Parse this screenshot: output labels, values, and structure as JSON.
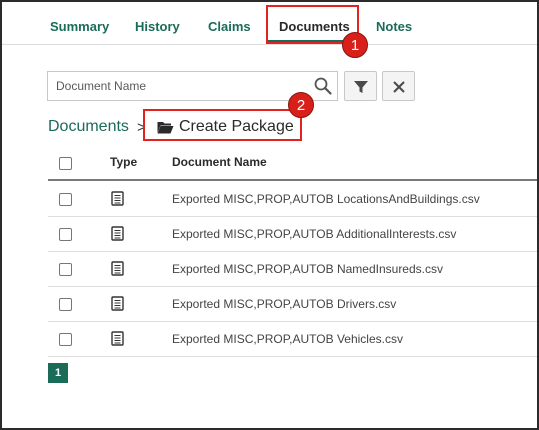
{
  "tabs": [
    {
      "label": "Summary"
    },
    {
      "label": "History"
    },
    {
      "label": "Claims"
    },
    {
      "label": "Documents",
      "active": true
    },
    {
      "label": "Notes"
    }
  ],
  "callouts": [
    "1",
    "2"
  ],
  "search": {
    "placeholder": "Document Name"
  },
  "toolbar": {
    "filter_icon": "filter-icon",
    "clear_icon": "close-icon"
  },
  "breadcrumb": {
    "root": "Documents",
    "separator": ">",
    "action_label": "Create Package",
    "action_icon": "folder-open-icon"
  },
  "table": {
    "columns": [
      "Type",
      "Document Name"
    ],
    "rows": [
      {
        "name": "Exported MISC,PROP,AUTOB LocationsAndBuildings.csv"
      },
      {
        "name": "Exported MISC,PROP,AUTOB AdditionalInterests.csv"
      },
      {
        "name": "Exported MISC,PROP,AUTOB NamedInsureds.csv"
      },
      {
        "name": "Exported MISC,PROP,AUTOB Drivers.csv"
      },
      {
        "name": "Exported MISC,PROP,AUTOB Vehicles.csv"
      }
    ]
  },
  "pagination": {
    "current": "1"
  },
  "colors": {
    "accent": "#1b6b59",
    "callout": "#e0231e"
  }
}
